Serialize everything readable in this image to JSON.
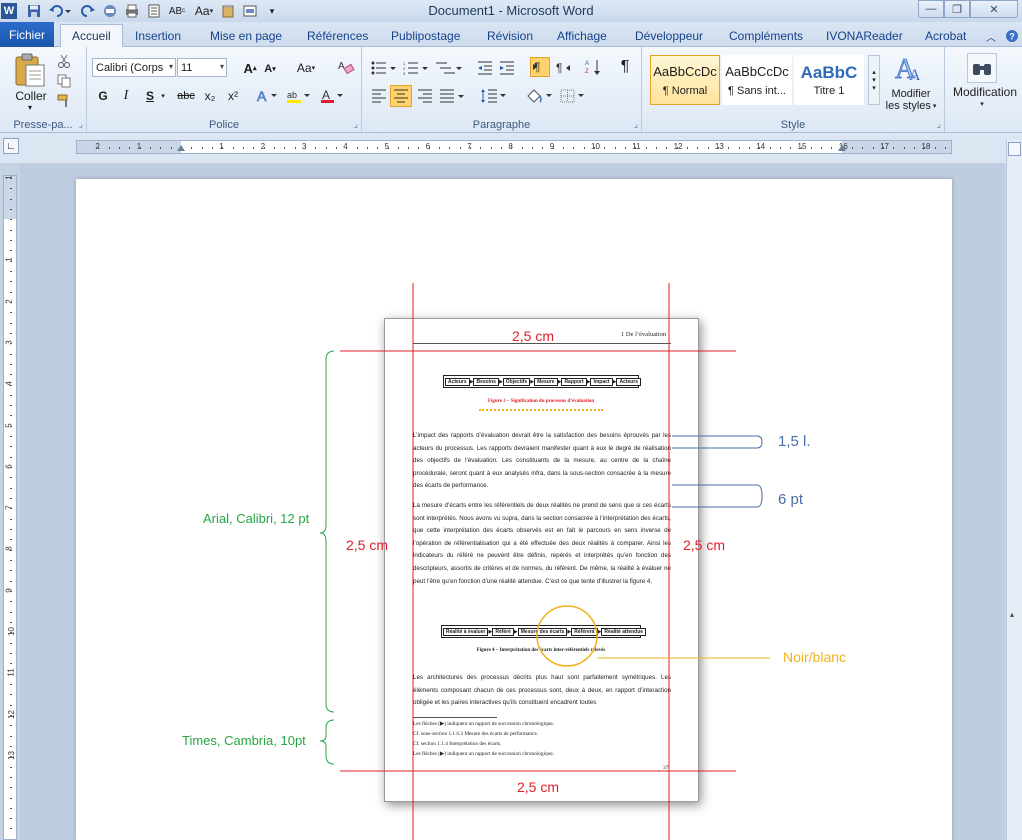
{
  "window": {
    "title": "Document1  -  Microsoft Word",
    "app_icon_letter": "W",
    "controls": {
      "minimize": "—",
      "restore": "❐",
      "close": "✕"
    }
  },
  "tabs": [
    {
      "label": "Fichier"
    },
    {
      "label": "Accueil"
    },
    {
      "label": "Insertion"
    },
    {
      "label": "Mise en page"
    },
    {
      "label": "Références"
    },
    {
      "label": "Publipostage"
    },
    {
      "label": "Révision"
    },
    {
      "label": "Affichage"
    },
    {
      "label": "Développeur"
    },
    {
      "label": "Compléments"
    },
    {
      "label": "IVONAReader"
    },
    {
      "label": "Acrobat"
    }
  ],
  "ribbon": {
    "clipboard": {
      "group_label": "Presse-pa...",
      "paste_label": "Coller"
    },
    "font": {
      "group_label": "Police",
      "font_name": "Calibri (Corps",
      "font_size": "11",
      "grow": "A",
      "shrink": "A",
      "case": "Aa",
      "bold": "G",
      "italic": "I",
      "underline": "S",
      "strike": "abc",
      "subscript": "x₂",
      "superscript": "x²"
    },
    "paragraph": {
      "group_label": "Paragraphe",
      "pilcrow": "¶"
    },
    "styles": {
      "group_label": "Style",
      "items": [
        {
          "preview": "AaBbCcDc",
          "name": "¶ Normal"
        },
        {
          "preview": "AaBbCcDc",
          "name": "¶ Sans int..."
        },
        {
          "preview": "AaBbC",
          "name": "Titre 1"
        }
      ],
      "modify_label_1": "Modifier",
      "modify_label_2": "les styles"
    },
    "editing": {
      "label": "Modification"
    }
  },
  "ruler": {
    "h_numbers": [
      "2",
      "1",
      "1",
      "2",
      "3",
      "4",
      "5",
      "6",
      "7",
      "8",
      "9",
      "10",
      "11",
      "12",
      "13",
      "14",
      "15",
      "16",
      "17",
      "18"
    ],
    "v_numbers": [
      "2",
      "1",
      "1",
      "2",
      "3",
      "4",
      "5",
      "6",
      "7",
      "8",
      "9",
      "10",
      "11",
      "12",
      "13"
    ]
  },
  "annotations": {
    "top_margin": "2,5 cm",
    "bottom_margin": "2,5 cm",
    "left_margin": "2,5 cm",
    "right_margin": "2,5 cm",
    "line_spacing": "1,5 l.",
    "paragraph_spacing": "6 pt",
    "body_font": "Arial, Calibri, 12 pt",
    "notes_font": "Times, Cambria, 10pt",
    "color_note": "Noir/blanc"
  },
  "thumbnail": {
    "header": "1  De l’évaluation",
    "flow1": [
      "Acteurs",
      "Besoins",
      "Objectifs",
      "Mesure",
      "Rapport",
      "Impact",
      "Acteurs"
    ],
    "figure3": "Figure 3 – Signification du processus d’évaluation",
    "para1": "L’impact des rapports d’évaluation devrait être la satisfaction des besoins éprouvés par les acteurs du processus. Les rapports devraient manifester quant à eux le degré de réalisation des objectifs de l’évaluation. Les constituants de la mesure, au centre de la chaîne procédurale, seront quant à eux analysés infra, dans la sous-section consacrée à la mesure des écarts de performance.",
    "para2": "La mesure d’écarts entre les référentiels de deux réalités ne prend de sens que si ces écarts sont interprétés. Nous avons vu supra, dans la section consacrée à l’interprétation des écarts, que cette interprétation des écarts observés est en fait le parcours en sens inverse de l’opération de référentialisation qui a été effectuée des deux réalités à comparer. Ainsi les indicateurs du référé ne peuvent être définis, repérés et interprétés qu’en fonction des descripteurs, assortis de critères et de normes, du référent. De même, la réalité à évaluer ne peut l’être qu’en fonction d’une réalité attendue. C’est ce que tente d’illustrer la figure 4.",
    "flow2": [
      "Réalité à évaluer",
      "Référé",
      "Mesure des écarts",
      "Référent",
      "Réalité attendue"
    ],
    "figure4": "Figure 4 – Interprétation des écarts inter-référentiels relevés",
    "para3": "Les architectures des processus décrits plus haut sont parfaitement symétriques. Les éléments composant chacun de ces processus sont, deux à deux, en rapport d’interaction obligée et les paires interactives qu’ils constituent encadrent toutes",
    "notes": [
      "Les flèches (▶) indiquent un rapport de succession chronologique.",
      "Cf. sous-section 1.1.6.3 Mesure des écarts de performance.",
      "Cf. section 1.1.4 Interprétation des écarts.",
      "Les flèches (▶) indiquent un rapport de succession chronologique."
    ],
    "page_number": "37"
  },
  "colors": {
    "margin_lines": "#e0202a",
    "spacing_annot": "#4a6ea8",
    "font_annot": "#27a644",
    "color_annot": "#f1b21a"
  }
}
